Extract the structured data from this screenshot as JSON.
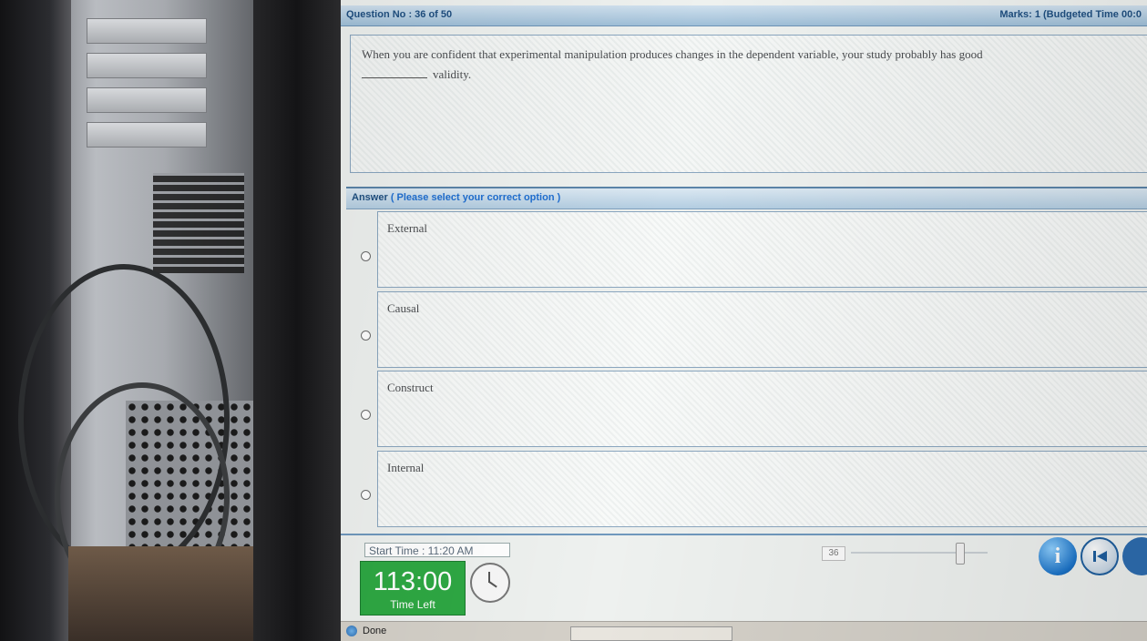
{
  "question_header": {
    "number": "Question No : 36 of 50",
    "marks": "Marks: 1 (Budgeted Time 00:0"
  },
  "question": {
    "text": "When you are confident that experimental manipulation produces changes in the dependent variable, your study probably has good",
    "text_after_blank": "validity."
  },
  "answer_header": {
    "title": "Answer",
    "hint": "( Please select your correct option )"
  },
  "options": [
    {
      "label": "External",
      "selected": false
    },
    {
      "label": "Causal",
      "selected": false
    },
    {
      "label": "Construct",
      "selected": false
    },
    {
      "label": "Internal",
      "selected": false
    }
  ],
  "footer": {
    "start_time": "Start Time : 11:20 AM",
    "timer_value": "113:00",
    "timer_label": "Time Left",
    "page_number": "36",
    "info_icon": "info-icon",
    "prev_icon": "skip-previous-icon"
  },
  "statusbar": {
    "status_text": "Done"
  },
  "colors": {
    "header_text": "#1f4f80",
    "hint_text": "#1f6ed0",
    "timer_bg": "#2ea843",
    "accent_border": "#6f98bd"
  }
}
